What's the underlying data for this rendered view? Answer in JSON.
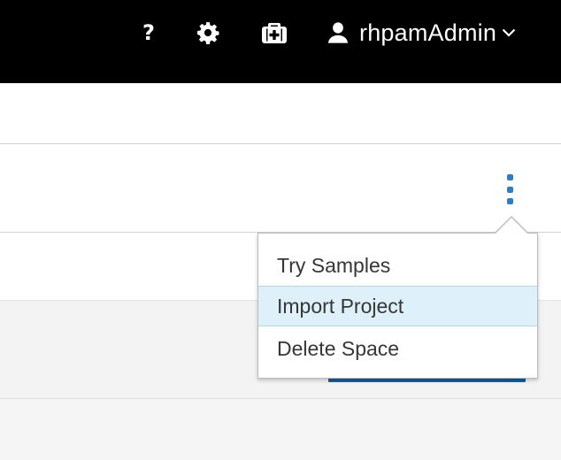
{
  "header": {
    "help_label": "?",
    "settings_icon": "gear-icon",
    "admin_icon": "medkit-icon",
    "user_icon": "user-icon",
    "username": "rhpamAdmin",
    "caret_icon": "chevron-down-icon"
  },
  "toolbar": {
    "kebab_icon": "kebab-vertical-icon"
  },
  "dropdown": {
    "items": [
      {
        "label": "Try Samples"
      },
      {
        "label": "Import Project"
      },
      {
        "label": "Delete Space"
      }
    ],
    "highlighted_index": 1
  },
  "colors": {
    "header_bg": "#000000",
    "accent": "#2b7fc8",
    "highlight_bg": "#def0fa",
    "primary_button": "#0a5fa8"
  }
}
